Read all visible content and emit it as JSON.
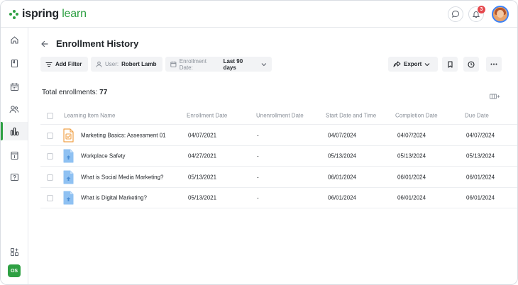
{
  "app": {
    "brand_main": "ispring",
    "brand_accent": "learn",
    "notification_count": "3",
    "user_initials": "OS"
  },
  "header": {
    "title": "Enrollment History"
  },
  "toolbar": {
    "add_filter": "Add Filter",
    "user_label": "User:",
    "user_value": "Robert Lamb",
    "date_label": "Enrollment Date:",
    "date_value": "Last 90 days",
    "export": "Export"
  },
  "summary": {
    "label": "Total enrollments:",
    "count": "77"
  },
  "table": {
    "columns": [
      "Learning Item Name",
      "Enrollment Date",
      "Unenrollment Date",
      "Start Date and Time",
      "Completion Date",
      "Due Date"
    ],
    "rows": [
      {
        "icon": "assessment-icon",
        "name": "Marketing Basics: Assessment 01",
        "enrollment": "04/07/2021",
        "unenrollment": "-",
        "start": "04/07/2024",
        "completion": "04/07/2024",
        "due": "04/07/2024"
      },
      {
        "icon": "course-file-icon",
        "name": "Workplace Safety",
        "enrollment": "04/27/2021",
        "unenrollment": "-",
        "start": "05/13/2024",
        "completion": "05/13/2024",
        "due": "05/13/2024"
      },
      {
        "icon": "course-file-icon",
        "name": "What is Social Media Marketing?",
        "enrollment": "05/13/2021",
        "unenrollment": "-",
        "start": "06/01/2024",
        "completion": "06/01/2024",
        "due": "06/01/2024"
      },
      {
        "icon": "course-file-icon",
        "name": "What is Digital  Marketing?",
        "enrollment": "05/13/2021",
        "unenrollment": "-",
        "start": "06/01/2024",
        "completion": "06/01/2024",
        "due": "06/01/2024"
      }
    ]
  },
  "colors": {
    "accent": "#2ea043",
    "badge": "#e5484d",
    "file_blue": "#8fc1f2",
    "assessment_orange": "#f0a24a"
  }
}
